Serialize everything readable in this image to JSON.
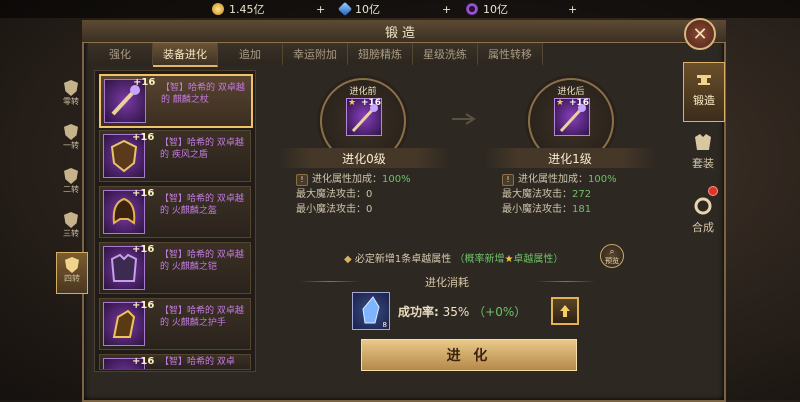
{
  "currency": [
    {
      "icon": "gold-coin-icon",
      "value": "1.45亿",
      "color": "#e5b540"
    },
    {
      "icon": "blue-gem-icon",
      "value": "10亿",
      "color": "#3a8fe0"
    },
    {
      "icon": "purple-ring-icon",
      "value": "10亿",
      "color": "#a454e0"
    }
  ],
  "title": "锻造",
  "tabs": [
    "强化",
    "装备进化",
    "追加",
    "幸运附加",
    "翅膀精炼",
    "星级洗练",
    "属性转移"
  ],
  "active_tab": 1,
  "ranks": [
    "零转",
    "一转",
    "二转",
    "三转",
    "四转"
  ],
  "active_rank": 4,
  "items": [
    {
      "plus": "+16",
      "name": "【智】哈希的 双卓越的 麒麟之杖"
    },
    {
      "plus": "+16",
      "name": "【智】哈希的 双卓越的 疾风之盾"
    },
    {
      "plus": "+16",
      "name": "【智】哈希的 双卓越的 火麒麟之盔"
    },
    {
      "plus": "+16",
      "name": "【智】哈希的 双卓越的 火麒麟之铠"
    },
    {
      "plus": "+16",
      "name": "【智】哈希的 双卓越的 火麒麟之护手"
    },
    {
      "plus": "+16",
      "name": "【智】哈希的 双卓"
    }
  ],
  "before": {
    "label": "进化前",
    "plus": "+16",
    "level": "进化0级",
    "bonus_label": "进化属性加成：",
    "bonus_value": "100%",
    "max_label": "最大魔法攻击：",
    "max_value": "0",
    "min_label": "最小魔法攻击：",
    "min_value": "0"
  },
  "after": {
    "label": "进化后",
    "plus": "+16",
    "level": "进化1级",
    "bonus_label": "进化属性加成：",
    "bonus_value": "100%",
    "max_label": "最大魔法攻击：",
    "max_value": "272",
    "min_label": "最小魔法攻击：",
    "min_value": "181"
  },
  "note": {
    "prefix": "必定新增1条卓越属性",
    "highlight": "（概率新增",
    "suffix": "卓越属性）"
  },
  "preview_label": "预览",
  "cost_title": "进化消耗",
  "cost_item_count": "8",
  "success_label": "成功率:",
  "success_value": "35%",
  "success_bonus": "（+0%）",
  "evolve_button": "进 化",
  "right_nav": [
    {
      "label": "锻造",
      "icon": "anvil-icon"
    },
    {
      "label": "套装",
      "icon": "armor-icon"
    },
    {
      "label": "合成",
      "icon": "ring-icon"
    }
  ]
}
